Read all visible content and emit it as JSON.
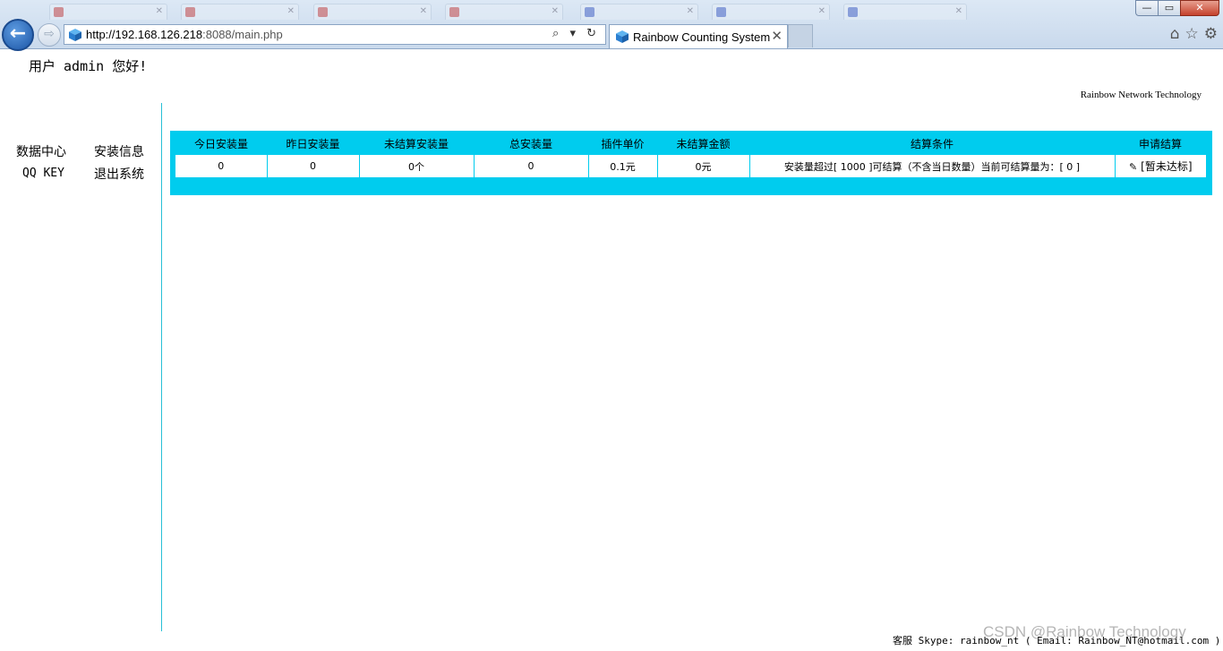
{
  "browser": {
    "window_controls": {
      "minimize": "—",
      "maximize": "▭",
      "close": "✕"
    },
    "url_host": "http://192.168.126.218",
    "url_rest": ":8088/main.php",
    "active_tab_title": "Rainbow Counting System",
    "tab_close": "✕",
    "address_tools": "⌕ ▾ ↻",
    "back_glyph": "←",
    "forward_glyph": "⇨"
  },
  "header": {
    "greeting": "用户 admin 您好!",
    "brand": "Rainbow Network Technology"
  },
  "sidebar": {
    "items": [
      {
        "label": "数据中心"
      },
      {
        "label": "安装信息"
      },
      {
        "label": "QQ KEY"
      },
      {
        "label": "退出系统"
      }
    ]
  },
  "stats": {
    "columns": [
      "今日安装量",
      "昨日安装量",
      "未结算安装量",
      "总安装量",
      "插件单价",
      "未结算金额",
      "结算条件",
      "申请结算"
    ],
    "row": {
      "today": "0",
      "yesterday": "0",
      "unsettled_installs": "0个",
      "total": "0",
      "unit_price": "0.1元",
      "unsettled_amount": "0元",
      "condition": "安装量超过[ 1000 ]可结算（不含当日数量）当前可结算量为：[ 0 ]",
      "apply": "[暂未达标]"
    }
  },
  "footer": {
    "text": "客服 Skype: rainbow_nt ( Email: Rainbow_NT@hotmail.com )"
  },
  "watermark": "CSDN @Rainbow Technology",
  "colors": {
    "accent": "#00ccee",
    "divider": "#28c0d6"
  }
}
